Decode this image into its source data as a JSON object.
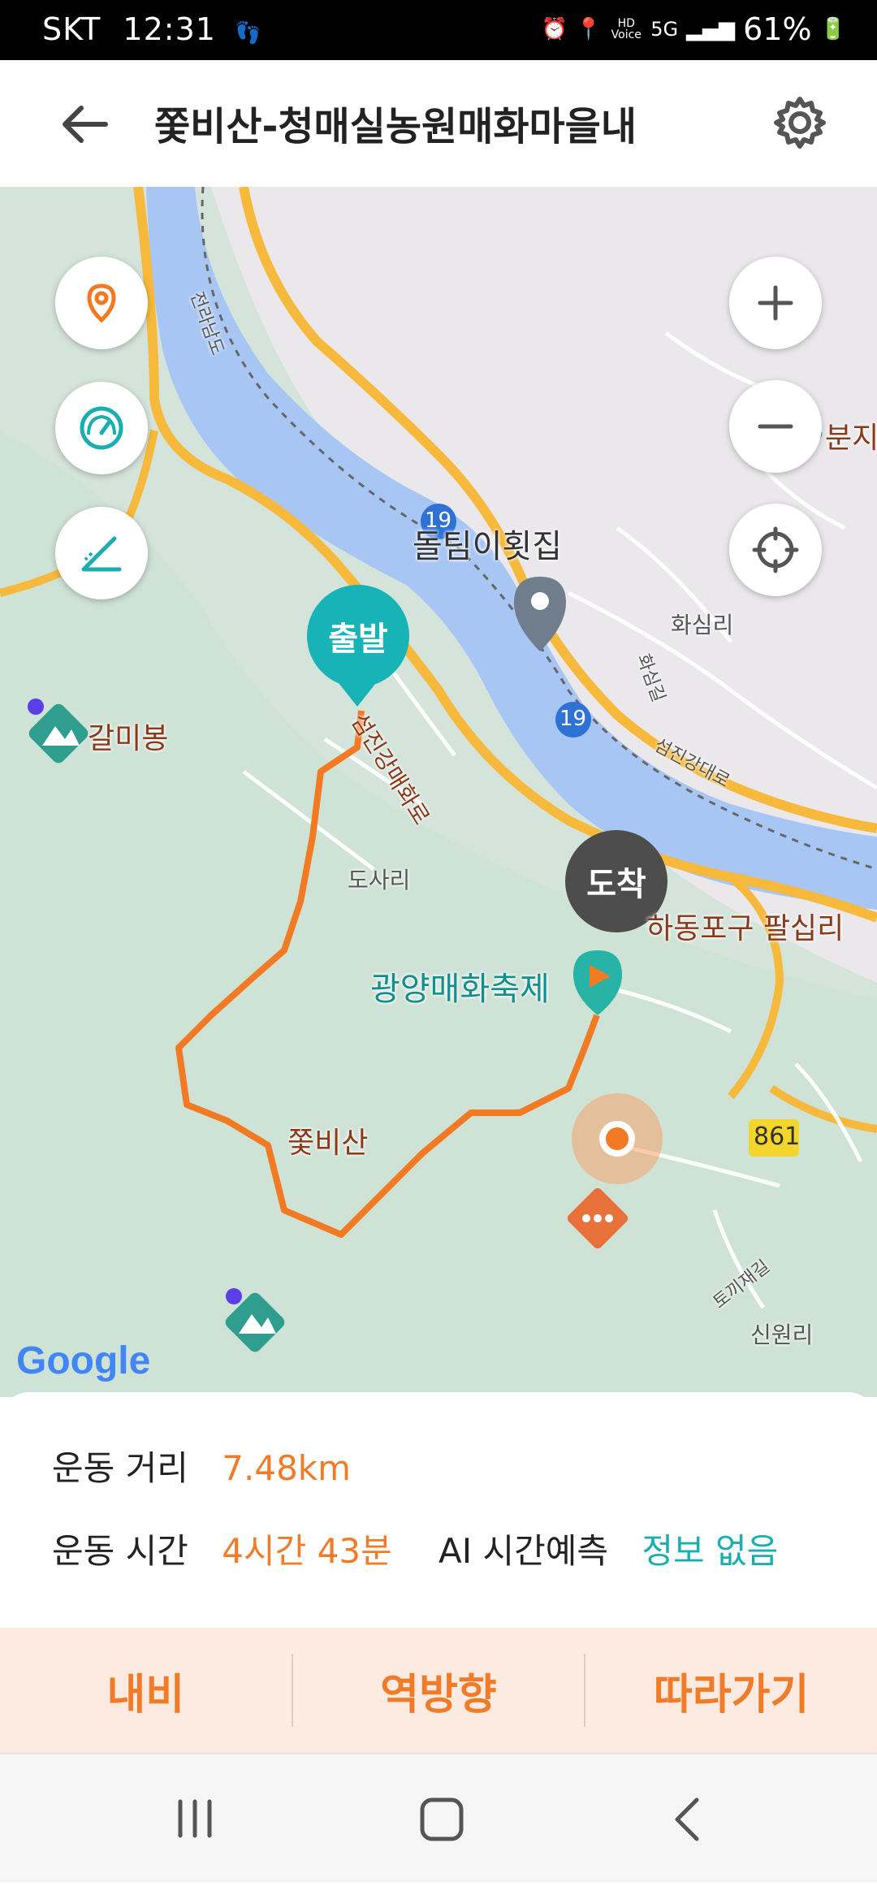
{
  "status_bar": {
    "carrier": "SKT",
    "time": "12:31",
    "battery": "61%",
    "network": "5G",
    "hd_voice": "HD Voice"
  },
  "header": {
    "title": "쫓비산-청매실농원매화마을내"
  },
  "map": {
    "labels": {
      "start": "출발",
      "end": "도착",
      "restaurant": "돌팀이횟집",
      "village_hwasim": "화심리",
      "galmi": "갈미봉",
      "dosari": "도사리",
      "festival": "광양매화축제",
      "jjotbi": "쫓비산",
      "hadong": "하동포구 팔십리",
      "sinwon": "신원리",
      "bunji": "분지",
      "road_19a": "19",
      "road_19b": "19",
      "road_861": "861",
      "road_seomjin": "섬진강매화로",
      "road_seomjin_dae": "섬진강대로",
      "road_hwasim": "화심길",
      "road_jeolla": "전라남도",
      "road_togi": "토끼재길",
      "google": "Google"
    }
  },
  "stats": {
    "distance_label": "운동 거리",
    "distance_value": "7.48km",
    "time_label": "운동 시간",
    "time_value": "4시간 43분",
    "ai_label": "AI 시간예측",
    "ai_value": "정보 없음"
  },
  "actions": {
    "navi": "내비",
    "reverse": "역방향",
    "follow": "따라가기"
  },
  "colors": {
    "accent": "#f07c2a",
    "teal": "#1aaeb0",
    "action_bg": "#fdeae0"
  }
}
